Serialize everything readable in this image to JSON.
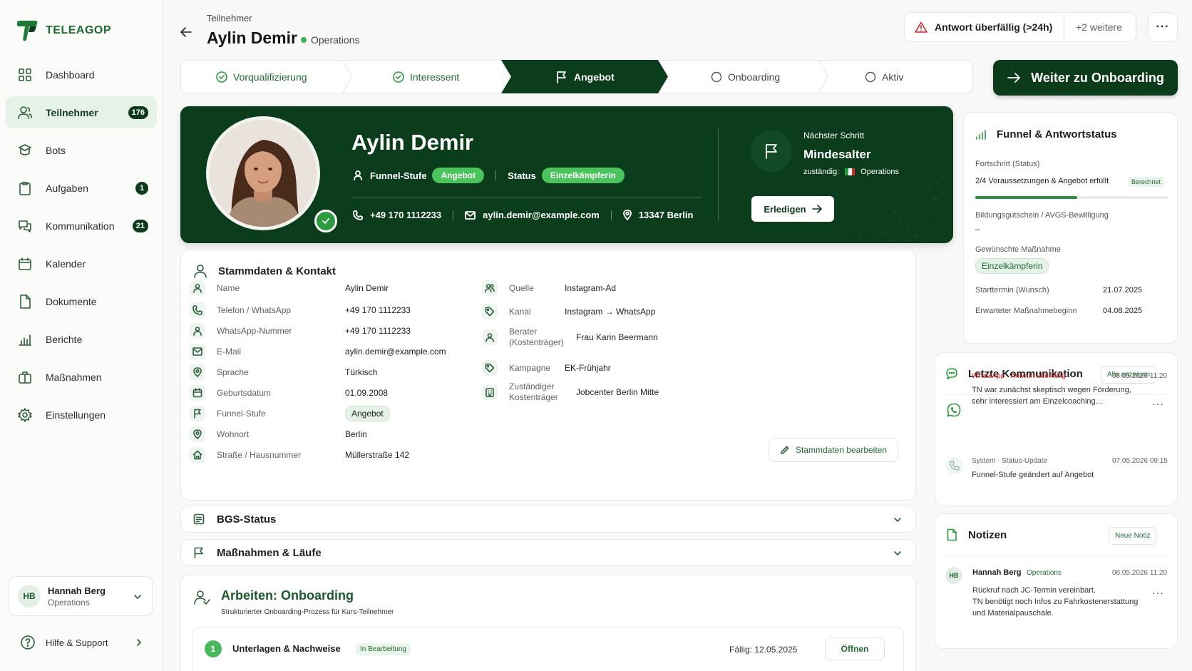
{
  "app": {
    "name": "TELEAGOP"
  },
  "sidebar": {
    "items": [
      {
        "label": "Dashboard",
        "icon": "grid-icon",
        "badge": ""
      },
      {
        "label": "Teilnehmer",
        "icon": "users-icon",
        "badge": "176",
        "active": true
      },
      {
        "label": "Bots",
        "icon": "bot-icon",
        "badge": ""
      },
      {
        "label": "Aufgaben",
        "icon": "clipboard-icon",
        "badge": "1"
      },
      {
        "label": "Kommunikation",
        "icon": "chat-icon",
        "badge": "21"
      },
      {
        "label": "Kalender",
        "icon": "calendar-icon",
        "badge": ""
      },
      {
        "label": "Dokumente",
        "icon": "document-icon",
        "badge": ""
      },
      {
        "label": "Berichte",
        "icon": "bar-chart-icon",
        "badge": ""
      },
      {
        "label": "Maßnahmen",
        "icon": "briefcase-icon",
        "badge": ""
      },
      {
        "label": "Einstellungen",
        "icon": "gear-icon",
        "badge": ""
      }
    ],
    "user": {
      "initials": "HB",
      "name": "Hannah Berg",
      "role": "Operations"
    },
    "help": "Hilfe & Support"
  },
  "header": {
    "breadcrumb": "Teilnehmer",
    "title": "Aylin Demir",
    "team": "Operations",
    "alert": "Antwort überfällig (>24h)",
    "alert_more": "+2 weitere",
    "more": "···"
  },
  "stepper": {
    "steps": [
      {
        "label": "Vorqualifizierung",
        "state": "done"
      },
      {
        "label": "Interessent",
        "state": "done"
      },
      {
        "label": "Angebot",
        "state": "active"
      },
      {
        "label": "Onboarding",
        "state": "todo"
      },
      {
        "label": "Aktiv",
        "state": "todo"
      }
    ],
    "next_button": "Weiter zu Onboarding"
  },
  "hero": {
    "name": "Aylin Demir",
    "funnel_label": "Funnel-Stufe",
    "funnel_value": "Angebot",
    "status_label": "Status",
    "status_value": "Einzelkämpferin",
    "phone": "+49 170 1112233",
    "email": "aylin.demir@example.com",
    "address": "13347 Berlin",
    "next_step_label": "Nächster Schritt",
    "next_step_title": "Mindesalter",
    "responsible_label": "zuständig:",
    "responsible_value": "Operations",
    "done_button": "Erledigen"
  },
  "stammdaten": {
    "title": "Stammdaten & Kontakt",
    "left": [
      {
        "label": "Name",
        "value": "Aylin Demir",
        "icon": "user-icon"
      },
      {
        "label": "Telefon / WhatsApp",
        "value": "+49 170 1112233",
        "icon": "phone-icon"
      },
      {
        "label": "WhatsApp-Nummer",
        "value": "+49 170 1112233",
        "icon": "user-icon"
      },
      {
        "label": "E-Mail",
        "value": "aylin.demir@example.com",
        "icon": "mail-icon"
      },
      {
        "label": "Sprache",
        "value": "Türkisch",
        "icon": "pin-icon"
      },
      {
        "label": "Geburtsdatum",
        "value": "01.09.2008",
        "icon": "calendar-icon"
      },
      {
        "label": "Funnel-Stufe",
        "value": "Angebot",
        "icon": "flag-icon"
      },
      {
        "label": "Wohnort",
        "value": "Berlin",
        "icon": "pin-icon"
      },
      {
        "label": "Straße / Hausnummer",
        "value": "Müllerstraße 142",
        "icon": "home-icon"
      }
    ],
    "right": [
      {
        "label": "Quelle",
        "value": "Instagram-Ad",
        "icon": "users-icon"
      },
      {
        "label": "Kanal",
        "value": "Instagram → WhatsApp",
        "icon": "tag-icon"
      },
      {
        "label": "Berater (Kostenträger)",
        "value": "Frau Karin Beermann",
        "icon": "user-icon"
      },
      {
        "label": "Kampagne",
        "value": "EK-Frühjahr",
        "icon": "tag-icon"
      },
      {
        "label": "Zuständiger Kostenträger",
        "value": "Jobcenter Berlin Mitte",
        "icon": "building-icon"
      }
    ],
    "edit_button": "Stammdaten bearbeiten"
  },
  "sections": {
    "bgs": "BGS-Status",
    "massnahmen": "Maßnahmen & Läufe"
  },
  "work": {
    "title": "Arbeiten: Onboarding",
    "subtitle": "Strukturierter Onboarding-Prozess für Kurs-Teilnehmer",
    "task": {
      "num": "1",
      "title": "Unterlagen & Nachweise",
      "status": "In Bearbeitung",
      "due": "Fällig: 12.05.2025",
      "open": "Öffnen"
    }
  },
  "funnel": {
    "title": "Funnel & Antwortstatus",
    "progress_label": "Fortschritt (Status)",
    "progress_text": "2/4 Voraussetzungen & Angebot erfüllt",
    "progress_tag": "Berechnet",
    "progress_value": 0.53,
    "bgs_label": "Bildungsgutschein / AVGS-Bewilligung",
    "bgs_value": "–",
    "measure_label": "Gewünschte Maßnahme",
    "measure_value": "Einzelkämpferin",
    "start_label": "Starttermin (Wunsch)",
    "start_value": "21.07.2025",
    "expected_label": "Erwarteter Maßnahmebeginn",
    "expected_value": "04.08.2025"
  },
  "communication": {
    "title": "Letzte Kommunikation",
    "show_all": "Alle anzeigen",
    "messages": [
      {
        "channel": "WhatsApp",
        "tag": "Antwort überfällig",
        "time": "08.05.2026 11:20",
        "line1": "TN war zunächst skeptisch wegen Förderung,",
        "line2": "sehr interessiert am Einzelcoaching…"
      },
      {
        "channel": "System",
        "tag": "Status-Update",
        "time": "07.05.2026 09:15",
        "line1": "Funnel-Stufe geändert auf Angebot"
      }
    ]
  },
  "notes": {
    "title": "Notizen",
    "new_button": "Neue Notiz",
    "items": [
      {
        "initials": "HB",
        "author": "Hannah Berg",
        "team": "Operations",
        "time": "08.05.2026 11:20",
        "line1": "Rückruf nach JC-Termin vereinbart.",
        "line2": "TN benötigt noch Infos zu Fahrkostenerstattung",
        "line3": "und Materialpauschale."
      }
    ]
  },
  "colors": {
    "brand": "#0b3d1c",
    "accent": "#49c55c",
    "alert": "#d42a2a"
  }
}
